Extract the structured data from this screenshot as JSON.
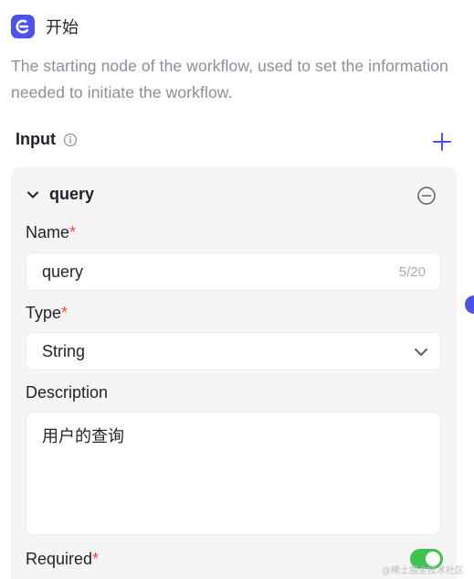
{
  "node": {
    "title": "开始",
    "description": "The starting node of the workflow, used to set the information needed to initiate the workflow.",
    "icon": "start-node-icon",
    "accent_color": "#4d53e8"
  },
  "inputs": {
    "label": "Input",
    "info_icon": "info-icon",
    "add_icon": "plus-icon"
  },
  "parameter": {
    "name": "query",
    "expanded": true,
    "remove_icon": "minus-circle-icon",
    "fields": {
      "name_label": "Name",
      "name_value": "query",
      "name_counter": "5/20",
      "type_label": "Type",
      "type_value": "String",
      "description_label": "Description",
      "description_value": "用户的查询",
      "required_label": "Required",
      "required_on": true,
      "required_marker": "*"
    }
  },
  "watermark": "@稀土掘金技术社区",
  "colors": {
    "required_star": "#f5483b",
    "toggle_on": "#3ec254",
    "panel_bg": "#f5f5f6"
  }
}
